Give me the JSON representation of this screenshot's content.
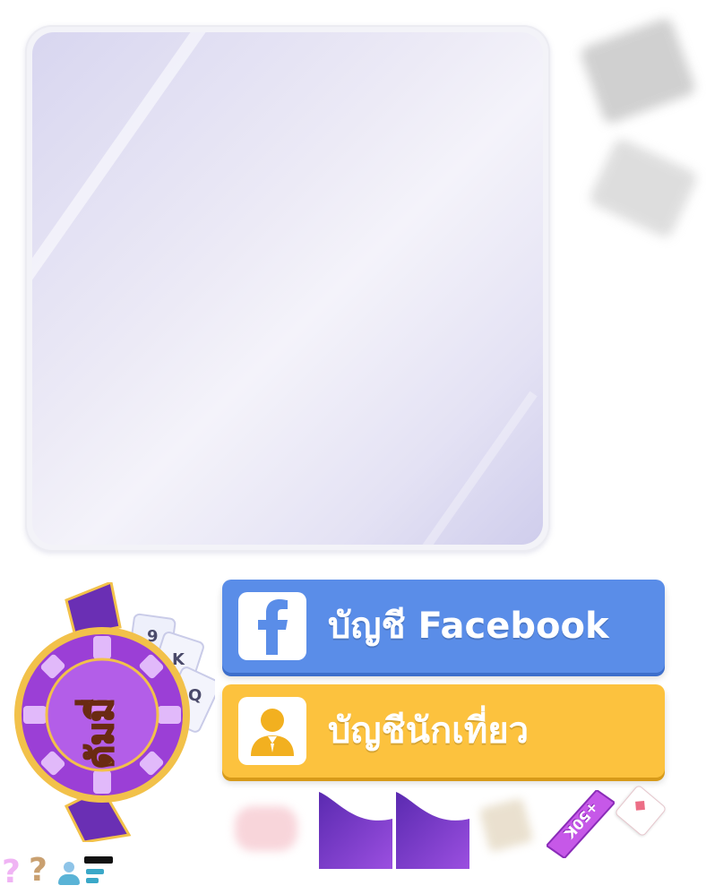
{
  "buttons": {
    "facebook_label": "บัญชี Facebook",
    "guest_label": "บัญชีนักเที่ยว"
  },
  "logo": {
    "text": "ดัมมี่"
  },
  "logo_cards": [
    "9",
    "K",
    "Q"
  ],
  "badge": {
    "text": "+50K"
  },
  "icons": {
    "facebook": "facebook-icon",
    "guest": "guest-user-icon",
    "help": "question-mark-icon"
  },
  "help_glyph": "?",
  "colors": {
    "facebook_blue": "#5a8de8",
    "guest_yellow": "#fcc23e",
    "panel": "#e6e4f4",
    "logo_purple": "#9b3fd6",
    "ribbon_purple": "#6a2fb4"
  }
}
